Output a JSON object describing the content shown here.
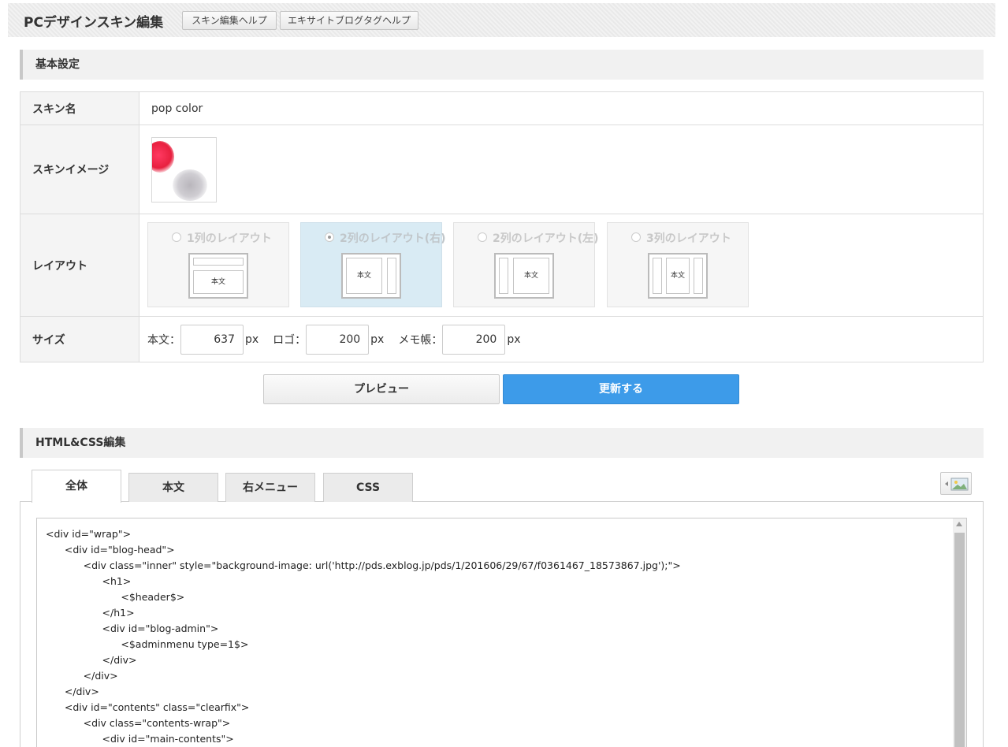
{
  "header": {
    "title": "PCデザインスキン編集",
    "help_skin": "スキン編集ヘルプ",
    "help_tag": "エキサイトブログタグヘルプ"
  },
  "basic": {
    "section_title": "基本設定",
    "skin_name_label": "スキン名",
    "skin_name_value": "pop color",
    "skin_image_label": "スキンイメージ",
    "layout_label": "レイアウト",
    "layout_options": [
      {
        "label": "1列のレイアウト",
        "selected": false,
        "body_text": "本文"
      },
      {
        "label": "2列のレイアウト(右)",
        "selected": true,
        "body_text": "本文"
      },
      {
        "label": "2列のレイアウト(左)",
        "selected": false,
        "body_text": "本文"
      },
      {
        "label": "3列のレイアウト",
        "selected": false,
        "body_text": "本文"
      }
    ],
    "size_label": "サイズ",
    "sizes": {
      "body_label": "本文：",
      "body_value": "637",
      "logo_label": "ロゴ：",
      "logo_value": "200",
      "memo_label": "メモ帳：",
      "memo_value": "200",
      "unit": "px"
    }
  },
  "actions": {
    "preview": "プレビュー",
    "update": "更新する"
  },
  "editor": {
    "section_title": "HTML&CSS編集",
    "tabs": [
      "全体",
      "本文",
      "右メニュー",
      "CSS"
    ],
    "active_tab": "全体",
    "code": "<div id=\"wrap\">\n      <div id=\"blog-head\">\n            <div class=\"inner\" style=\"background-image: url('http://pds.exblog.jp/pds/1/201606/29/67/f0361467_18573867.jpg');\">\n                  <h1>\n                        <$header$>\n                  </h1>\n                  <div id=\"blog-admin\">\n                        <$adminmenu type=1$>\n                  </div>\n            </div>\n      </div>\n      <div id=\"contents\" class=\"clearfix\">\n            <div class=\"contents-wrap\">\n                  <div id=\"main-contents\">"
  }
}
